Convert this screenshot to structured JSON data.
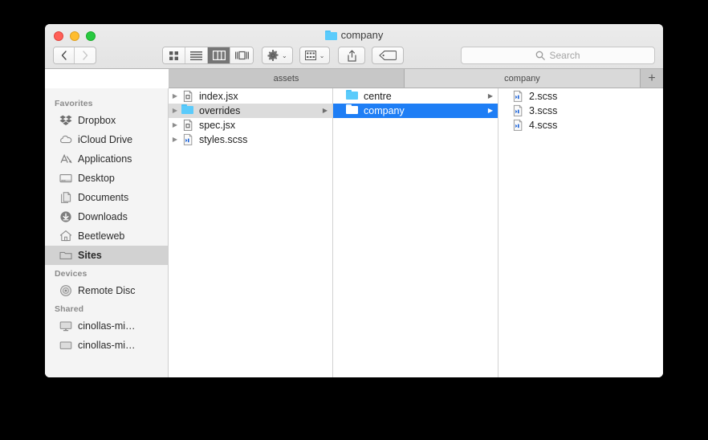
{
  "window": {
    "title": "company",
    "title_icon": "folder-icon",
    "traffic_lights": [
      {
        "name": "close",
        "color": "#ff5f57"
      },
      {
        "name": "minimize",
        "color": "#ffbd2e"
      },
      {
        "name": "zoom",
        "color": "#28c940"
      }
    ]
  },
  "toolbar": {
    "back_label": "‹",
    "forward_label": "›",
    "view_modes": [
      {
        "name": "icon-view",
        "active": false
      },
      {
        "name": "list-view",
        "active": false
      },
      {
        "name": "column-view",
        "active": true
      },
      {
        "name": "gallery-view",
        "active": false
      }
    ],
    "action_label": "gear-icon",
    "arrange_label": "arrange-icon",
    "share_label": "share-icon",
    "tag_label": "tag-icon",
    "caret": "⌄"
  },
  "search": {
    "placeholder": "Search",
    "icon": "search-icon"
  },
  "tabs": {
    "items": [
      {
        "label": "assets",
        "active": false
      },
      {
        "label": "company",
        "active": true
      }
    ],
    "add_label": "+"
  },
  "sidebar": {
    "sections": [
      {
        "header": "Favorites",
        "items": [
          {
            "label": "Dropbox",
            "icon": "dropbox-icon",
            "selected": false
          },
          {
            "label": "iCloud Drive",
            "icon": "cloud-icon",
            "selected": false
          },
          {
            "label": "Applications",
            "icon": "applications-icon",
            "selected": false
          },
          {
            "label": "Desktop",
            "icon": "desktop-icon",
            "selected": false
          },
          {
            "label": "Documents",
            "icon": "documents-icon",
            "selected": false
          },
          {
            "label": "Downloads",
            "icon": "downloads-icon",
            "selected": false
          },
          {
            "label": "Beetleweb",
            "icon": "home-icon",
            "selected": false
          },
          {
            "label": "Sites",
            "icon": "folder-icon",
            "selected": true
          }
        ]
      },
      {
        "header": "Devices",
        "items": [
          {
            "label": "Remote Disc",
            "icon": "disc-icon",
            "selected": false
          }
        ]
      },
      {
        "header": "Shared",
        "items": [
          {
            "label": "cinollas-mi…",
            "icon": "imac-icon",
            "selected": false
          },
          {
            "label": "cinollas-mi…",
            "icon": "display-icon",
            "selected": false
          }
        ]
      }
    ]
  },
  "columns": [
    {
      "name": "column-1",
      "rows": [
        {
          "label": "index.jsx",
          "icon": "jsx-file-icon",
          "kind": "file",
          "selected": "none",
          "disclosure": true,
          "chevron": false
        },
        {
          "label": "overrides",
          "icon": "folder-icon",
          "kind": "folder",
          "selected": "gray",
          "disclosure": true,
          "chevron": true
        },
        {
          "label": "spec.jsx",
          "icon": "jsx-file-icon",
          "kind": "file",
          "selected": "none",
          "disclosure": true,
          "chevron": false
        },
        {
          "label": "styles.scss",
          "icon": "scss-file-icon",
          "kind": "file",
          "selected": "none",
          "disclosure": true,
          "chevron": false
        }
      ]
    },
    {
      "name": "column-2",
      "rows": [
        {
          "label": "centre",
          "icon": "folder-icon",
          "kind": "folder",
          "selected": "none",
          "disclosure": false,
          "chevron": true
        },
        {
          "label": "company",
          "icon": "folder-icon",
          "kind": "folder",
          "selected": "blue",
          "disclosure": false,
          "chevron": true
        }
      ]
    },
    {
      "name": "column-3",
      "rows": [
        {
          "label": "2.scss",
          "icon": "scss-file-icon",
          "kind": "file",
          "selected": "none",
          "disclosure": false,
          "chevron": false
        },
        {
          "label": "3.scss",
          "icon": "scss-file-icon",
          "kind": "file",
          "selected": "none",
          "disclosure": false,
          "chevron": false
        },
        {
          "label": "4.scss",
          "icon": "scss-file-icon",
          "kind": "file",
          "selected": "none",
          "disclosure": false,
          "chevron": false
        }
      ]
    }
  ],
  "colors": {
    "selection_blue": "#1e7ef5",
    "selection_gray": "#dcdcdc",
    "folder_blue": "#5bcbfb",
    "sidebar_bg": "#f4f4f4"
  }
}
